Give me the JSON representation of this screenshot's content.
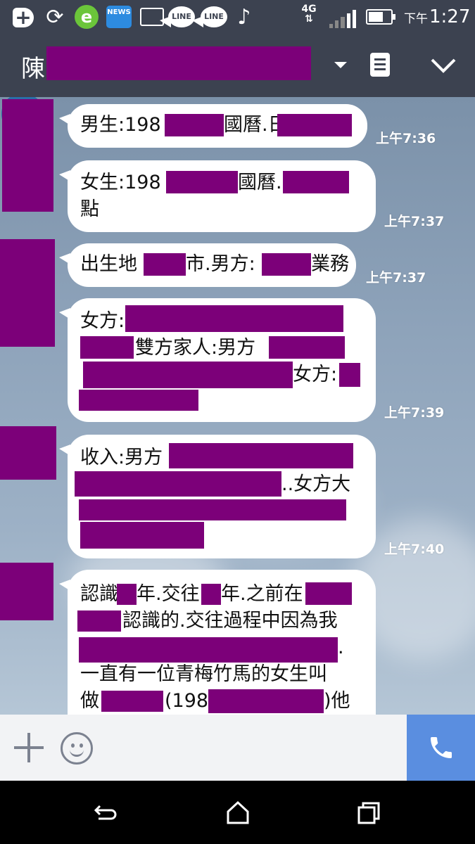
{
  "status_bar": {
    "news_label": "NEWS",
    "line_label": "LINE",
    "network": "4G",
    "ampm": "下午",
    "time": "1:27"
  },
  "header": {
    "title_prefix": "陳"
  },
  "messages": [
    {
      "parts": [
        "男生:198",
        "國曆.日"
      ],
      "time": "上午7:36"
    },
    {
      "parts": [
        "女生:198",
        "國曆.",
        "點"
      ],
      "time": "上午7:37"
    },
    {
      "parts": [
        "出生地",
        "市.男方:",
        "業務"
      ],
      "time": "上午7:37"
    },
    {
      "parts": [
        "女方:",
        "雙方家人:男方",
        "女方:"
      ],
      "time": "上午7:39"
    },
    {
      "parts": [
        "收入:男方",
        "..女方大"
      ],
      "time": "上午7:40"
    },
    {
      "parts": [
        "認識",
        "年.交往",
        "年.之前在",
        "認識的.交往過程中因為我",
        ".",
        "一直有一位青梅竹馬的女生叫",
        "做",
        "(198",
        ")他"
      ],
      "time": ""
    }
  ]
}
